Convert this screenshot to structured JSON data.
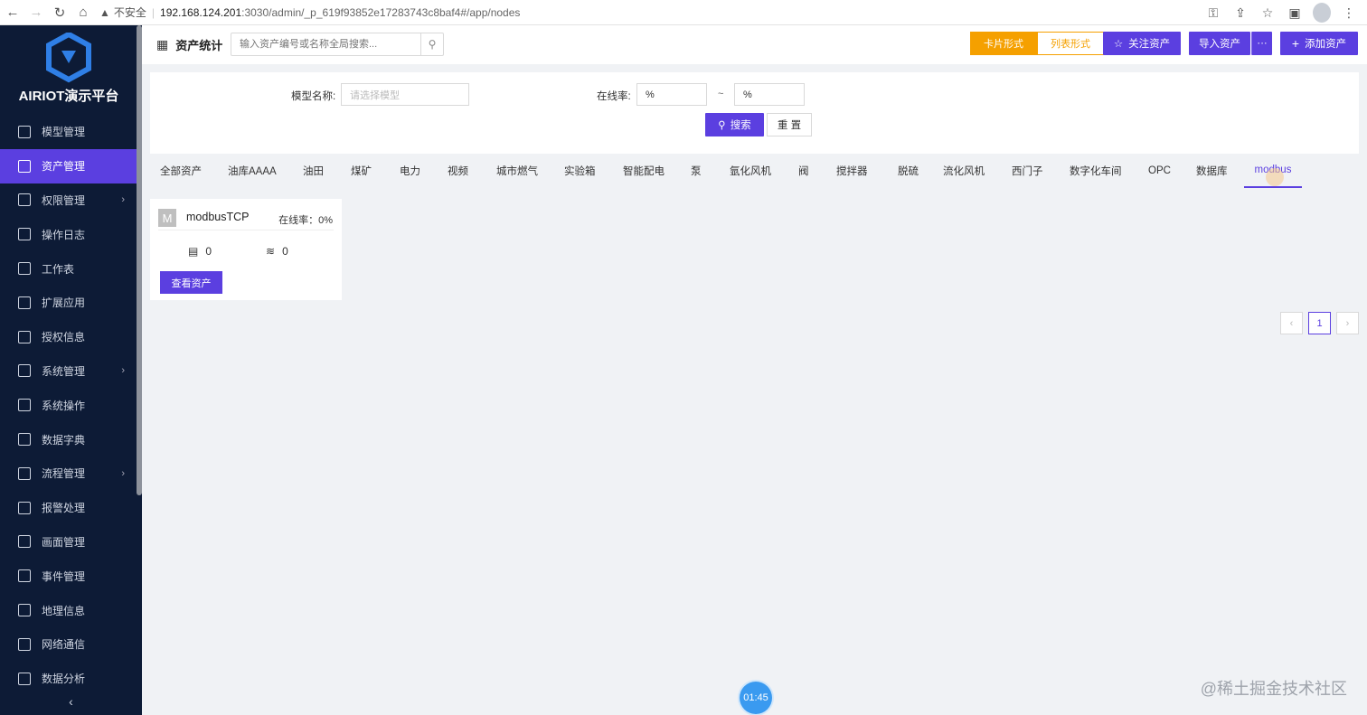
{
  "browser": {
    "insecure_label": "不安全",
    "url_host": "192.168.124.201",
    "url_path": ":3030/admin/_p_619f93852e17283743c8baf4#/app/nodes"
  },
  "sidebar": {
    "brand": "AIRIOT演示平台",
    "items": [
      {
        "label": "模型管理",
        "icon": "model-icon"
      },
      {
        "label": "资产管理",
        "icon": "asset-grid-icon",
        "active": true
      },
      {
        "label": "权限管理",
        "icon": "lock-icon",
        "has_children": true
      },
      {
        "label": "操作日志",
        "icon": "edit-log-icon"
      },
      {
        "label": "工作表",
        "icon": "worksheet-icon"
      },
      {
        "label": "扩展应用",
        "icon": "extension-icon"
      },
      {
        "label": "授权信息",
        "icon": "license-icon"
      },
      {
        "label": "系统管理",
        "icon": "gear-icon",
        "has_children": true
      },
      {
        "label": "系统操作",
        "icon": "system-op-icon"
      },
      {
        "label": "数据字典",
        "icon": "dictionary-icon"
      },
      {
        "label": "流程管理",
        "icon": "flow-icon",
        "has_children": true
      },
      {
        "label": "报警处理",
        "icon": "alarm-icon"
      },
      {
        "label": "画面管理",
        "icon": "screen-icon"
      },
      {
        "label": "事件管理",
        "icon": "event-icon"
      },
      {
        "label": "地理信息",
        "icon": "map-icon"
      },
      {
        "label": "网络通信",
        "icon": "network-icon"
      },
      {
        "label": "数据分析",
        "icon": "analysis-icon"
      }
    ],
    "collapse_icon": "‹"
  },
  "topbar": {
    "title": "资产统计",
    "search_placeholder": "输入资产编号或名称全局搜索...",
    "view_card": "卡片形式",
    "view_list": "列表形式",
    "follow_btn": "关注资产",
    "import_btn": "导入资产",
    "more_btn": "···",
    "add_btn": "添加资产"
  },
  "filter": {
    "model_label": "模型名称:",
    "model_placeholder": "请选择模型",
    "rate_label": "在线率:",
    "rate_min": "%",
    "rate_sep": "~",
    "rate_max": "%",
    "search_btn": "搜索",
    "reset_btn": "重 置"
  },
  "tabs": [
    "全部资产",
    "油库AAAA",
    "油田",
    "煤矿",
    "电力",
    "视频",
    "城市燃气",
    "实验箱",
    "智能配电",
    "泵",
    "氩化风机",
    "阀",
    "搅拌器",
    "脱硫",
    "流化风机",
    "西门子",
    "数字化车间",
    "OPC",
    "数据库",
    "modbus"
  ],
  "active_tab": "modbus",
  "card": {
    "initial": "M",
    "name": "modbusTCP",
    "rate": "在线率：0%",
    "device_count": "0",
    "online_count": "0",
    "view_btn": "查看资产"
  },
  "pagination": {
    "prev": "‹",
    "page": "1",
    "next": "›"
  },
  "watermark": "@稀土掘金技术社区",
  "timer": "01:45"
}
